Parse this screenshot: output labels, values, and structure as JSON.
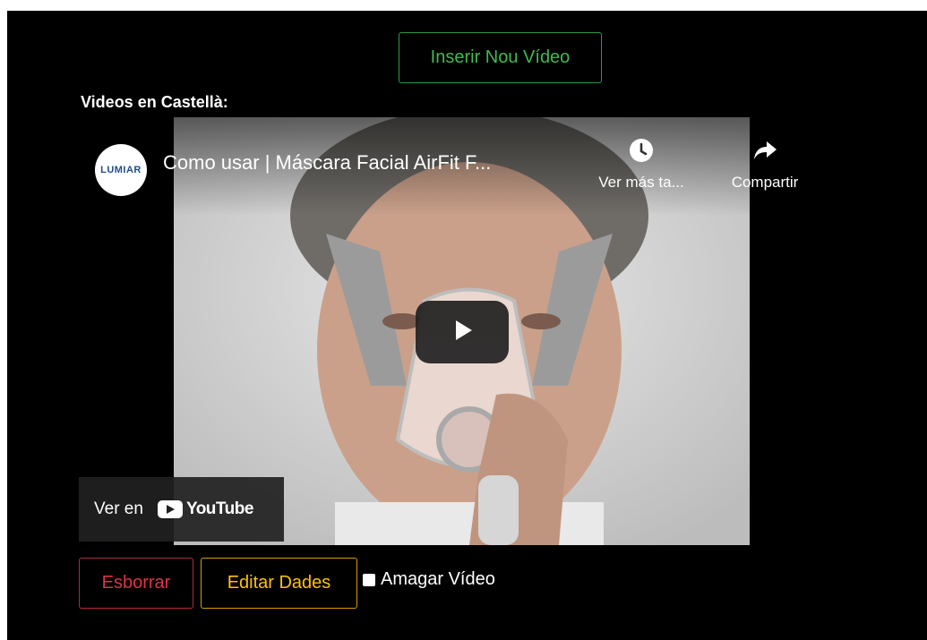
{
  "actions": {
    "insert_label": "Inserir Nou Vídeo",
    "delete_label": "Esborrar",
    "edit_label": "Editar Dades",
    "hide_label": "Amagar Vídeo",
    "hide_checked": false
  },
  "section": {
    "title": "Videos en Castellà:"
  },
  "video": {
    "channel_logo_text": "LUMIAR",
    "title": "Como usar | Máscara Facial AirFit F...",
    "watch_later_label": "Ver más ta...",
    "share_label": "Compartir",
    "watch_on_label": "Ver en",
    "youtube_label": "YouTube",
    "icons": [
      "clock-icon",
      "share-arrow-icon",
      "play-icon",
      "youtube-logo-icon"
    ]
  },
  "colors": {
    "insert": "#3fb950",
    "delete": "#dc3545",
    "edit": "#ffc107",
    "background": "#000000"
  }
}
